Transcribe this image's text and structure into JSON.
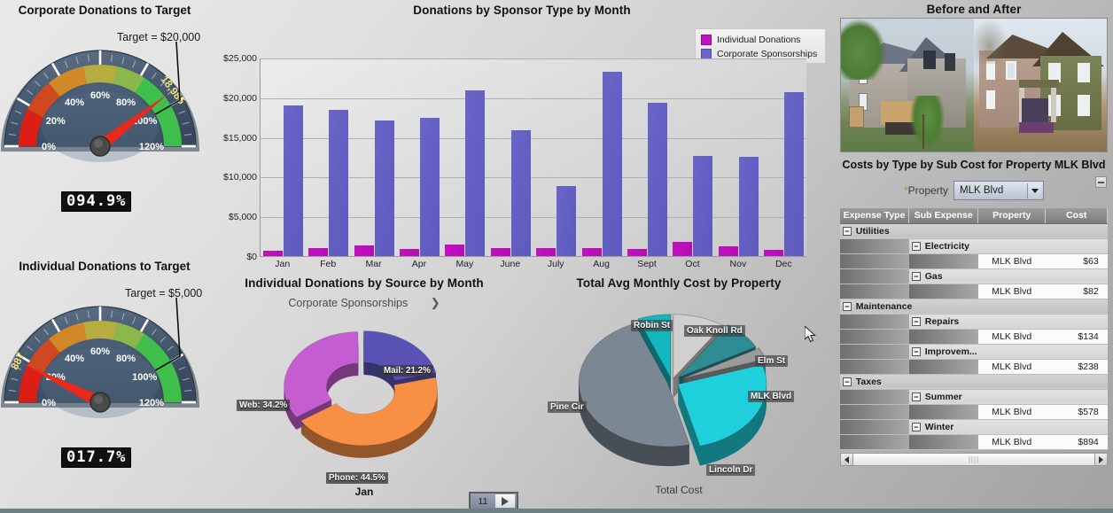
{
  "gauges": [
    {
      "title": "Corporate Donations to Target",
      "target_label": "Target = $20,000",
      "value_label": "18,985",
      "readout": "094.9%",
      "percent": 94.9,
      "ticks": [
        "0%",
        "20%",
        "40%",
        "60%",
        "80%",
        "100%",
        "120%"
      ]
    },
    {
      "title": "Individual Donations to Target",
      "target_label": "Target = $5,000",
      "value_label": "887",
      "readout": "017.7%",
      "percent": 17.7,
      "ticks": [
        "0%",
        "20%",
        "40%",
        "60%",
        "80%",
        "100%",
        "120%"
      ]
    }
  ],
  "chart_data": [
    {
      "type": "bar",
      "title": "Donations by Sponsor Type by Month",
      "xlabel": "",
      "ylabel": "",
      "ylim": [
        0,
        25000
      ],
      "yticks": [
        "$0",
        "$5,000",
        "$10,000",
        "$15,000",
        "$20,000",
        "$25,000"
      ],
      "ytick_values": [
        0,
        5000,
        10000,
        15000,
        20000,
        25000
      ],
      "grid": true,
      "legend_position": "top-right",
      "categories": [
        "Jan",
        "Feb",
        "Mar",
        "Apr",
        "May",
        "June",
        "July",
        "Aug",
        "Sept",
        "Oct",
        "Nov",
        "Dec"
      ],
      "series": [
        {
          "name": "Individual Donations",
          "color": "#c211c0",
          "values": [
            620,
            980,
            1330,
            860,
            1420,
            1010,
            960,
            1010,
            840,
            1740,
            1180,
            750
          ]
        },
        {
          "name": "Corporate Sponsorships",
          "color": "#6a66c8",
          "values": [
            19000,
            18400,
            17100,
            17400,
            20900,
            15900,
            8800,
            23200,
            19300,
            12600,
            12500,
            20700
          ]
        }
      ]
    },
    {
      "type": "pie",
      "title": "Individual Donations by Source by Month",
      "subtitle": "Corporate Sponsorships",
      "category_label": "Jan",
      "donut": true,
      "labels": [
        "Mail: 21.2%",
        "Phone: 44.5%",
        "Web: 34.2%"
      ],
      "slice_names": [
        "Mail",
        "Phone",
        "Web"
      ],
      "values": [
        21.2,
        44.5,
        34.2
      ],
      "colors": [
        "#5a53b5",
        "#f79045",
        "#c45ed0"
      ]
    },
    {
      "type": "pie",
      "title": "Total Avg Monthly Cost by Property",
      "category_label": "Total Cost",
      "slice_names": [
        "Oak Knoll Rd",
        "Elm St",
        "MLK Blvd",
        "Lincoln Dr",
        "Pine Cir",
        "Robin St"
      ],
      "values": [
        9.5,
        7.5,
        3.0,
        26.0,
        48.0,
        6.0
      ],
      "colors": [
        "#d0d0d0",
        "#2e8c93",
        "#9a9a9a",
        "#1fd0dc",
        "#7c8794",
        "#12b6bd"
      ]
    }
  ],
  "photos": {
    "title": "Before and After",
    "items": [
      "before-house-photo",
      "after-house-photo"
    ]
  },
  "table_panel": {
    "title": "Costs by Type by Sub Cost for Property MLK Blvd",
    "minimize_icon": "minimize-icon",
    "property_filter_label": "*Property",
    "property_filter_asterisk": "*",
    "property_filter_text": "Property",
    "property_value": "MLK Blvd",
    "dropdown_icon": "chevron-down-icon",
    "columns": [
      "Expense Type",
      "Sub Expense",
      "Property",
      "Cost"
    ],
    "rows": [
      {
        "level": 1,
        "expander": "−",
        "label": "Utilities"
      },
      {
        "level": 2,
        "expander": "−",
        "label": "Electricity"
      },
      {
        "level": 3,
        "property": "MLK Blvd",
        "cost": "$63"
      },
      {
        "level": 2,
        "expander": "−",
        "label": "Gas"
      },
      {
        "level": 3,
        "property": "MLK Blvd",
        "cost": "$82"
      },
      {
        "level": 1,
        "expander": "−",
        "label": "Maintenance"
      },
      {
        "level": 2,
        "expander": "−",
        "label": "Repairs"
      },
      {
        "level": 3,
        "property": "MLK Blvd",
        "cost": "$134"
      },
      {
        "level": 2,
        "expander": "−",
        "label": "Improvem..."
      },
      {
        "level": 3,
        "property": "MLK Blvd",
        "cost": "$238"
      },
      {
        "level": 1,
        "expander": "−",
        "label": "Taxes"
      },
      {
        "level": 2,
        "expander": "−",
        "label": "Summer"
      },
      {
        "level": 3,
        "property": "MLK Blvd",
        "cost": "$578"
      },
      {
        "level": 2,
        "expander": "−",
        "label": "Winter"
      },
      {
        "level": 3,
        "property": "MLK Blvd",
        "cost": "$894"
      }
    ],
    "scroll_left_icon": "arrow-left-icon",
    "scroll_right_icon": "arrow-right-icon"
  },
  "pager": {
    "value": "11",
    "play_icon": "play-icon"
  }
}
